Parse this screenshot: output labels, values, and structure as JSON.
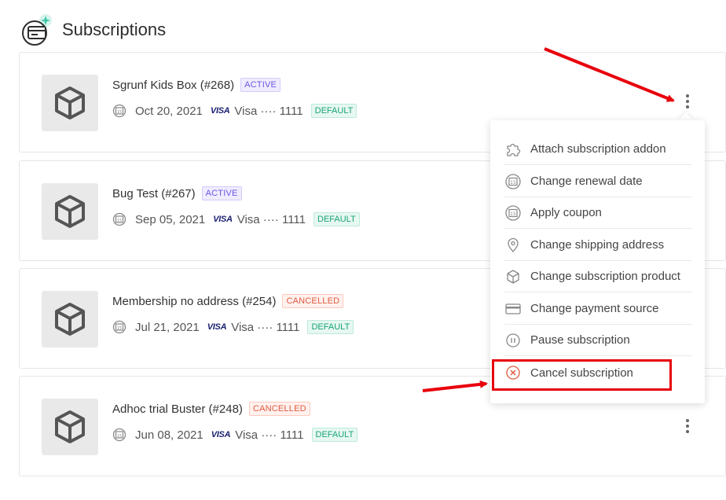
{
  "page": {
    "title": "Subscriptions"
  },
  "subscriptions": [
    {
      "name": "Sgrunf Kids Box (#268)",
      "status": "ACTIVE",
      "date": "Oct 20, 2021",
      "card_brand": "VISA",
      "card": "Visa ···· 1111",
      "default": "DEFAULT"
    },
    {
      "name": "Bug Test (#267)",
      "status": "ACTIVE",
      "date": "Sep 05, 2021",
      "card_brand": "VISA",
      "card": "Visa ···· 1111",
      "default": "DEFAULT"
    },
    {
      "name": "Membership no address (#254)",
      "status": "CANCELLED",
      "date": "Jul 21, 2021",
      "card_brand": "VISA",
      "card": "Visa ···· 1111",
      "default": "DEFAULT"
    },
    {
      "name": "Adhoc trial Buster (#248)",
      "status": "CANCELLED",
      "date": "Jun 08, 2021",
      "card_brand": "VISA",
      "card": "Visa ···· 1111",
      "default": "DEFAULT"
    }
  ],
  "menu": {
    "items": [
      {
        "label": "Attach subscription addon",
        "icon": "puzzle-icon"
      },
      {
        "label": "Change renewal date",
        "icon": "calendar-icon"
      },
      {
        "label": "Apply coupon",
        "icon": "calendar-icon"
      },
      {
        "label": "Change shipping address",
        "icon": "location-pin-icon"
      },
      {
        "label": "Change subscription product",
        "icon": "box-icon"
      },
      {
        "label": "Change payment source",
        "icon": "credit-card-icon"
      },
      {
        "label": "Pause subscription",
        "icon": "pause-icon"
      },
      {
        "label": "Cancel subscription",
        "icon": "cancel-circle-icon"
      }
    ]
  },
  "colors": {
    "active": "#6f55e0",
    "cancelled": "#e0593f",
    "default": "#1aa37a",
    "annotation": "#e8000c",
    "icon_accent": "#3ec6a8"
  }
}
